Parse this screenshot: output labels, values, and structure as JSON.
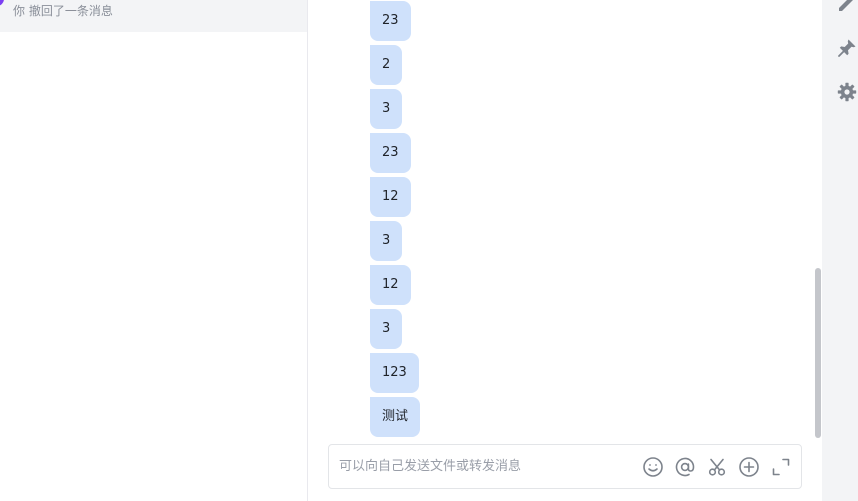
{
  "conversation_list": {
    "items": [
      {
        "preview": "你 撤回了一条消息"
      }
    ]
  },
  "chat": {
    "messages": [
      {
        "text": "23"
      },
      {
        "text": "2"
      },
      {
        "text": "3"
      },
      {
        "text": "23"
      },
      {
        "text": "12"
      },
      {
        "text": "3"
      },
      {
        "text": "12"
      },
      {
        "text": "3"
      },
      {
        "text": "123"
      },
      {
        "text": "测试"
      }
    ]
  },
  "composer": {
    "placeholder": "可以向自己发送文件或转发消息",
    "value": "",
    "tools": [
      "emoji-icon",
      "mention-icon",
      "scissors-icon",
      "add-circle-icon",
      "expand-icon"
    ]
  },
  "right_toolbar": {
    "icons": [
      "edit-icon",
      "pin-icon",
      "gear-icon"
    ]
  },
  "colors": {
    "bubble": "#cfe1fb",
    "avatar": "#7b3ff2",
    "panel_bg": "#f3f4f6",
    "icon": "#7d838c"
  }
}
